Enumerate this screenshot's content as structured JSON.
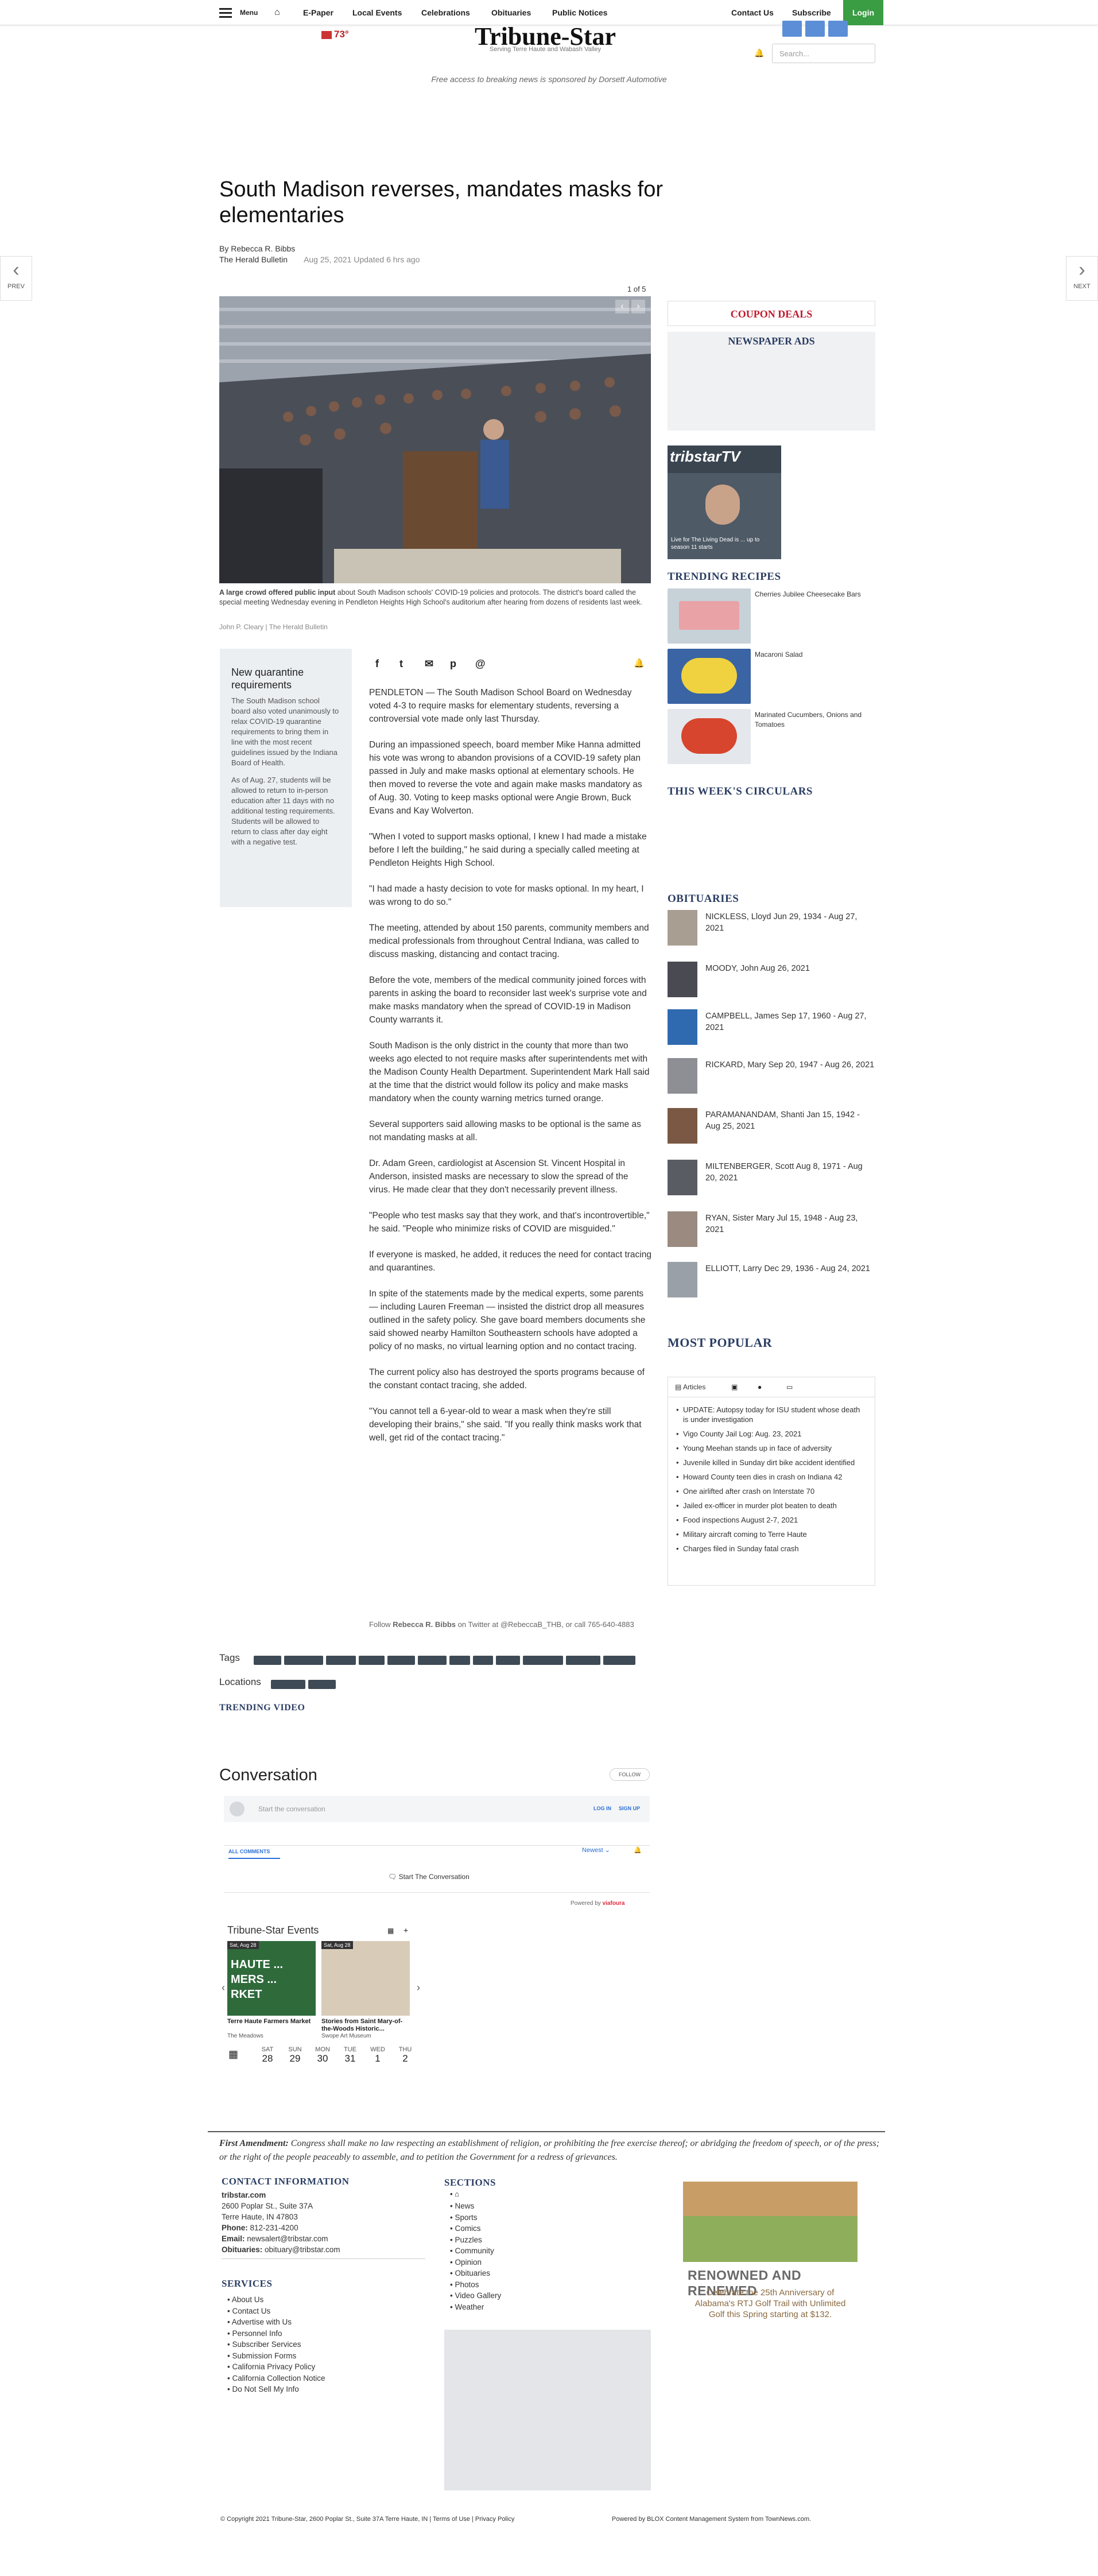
{
  "topnav": {
    "menu": "Menu",
    "items": [
      "E-Paper",
      "Local Events",
      "Celebrations",
      "Obituaries",
      "Public Notices"
    ],
    "right": [
      "Contact Us",
      "Subscribe"
    ],
    "login": "Login"
  },
  "masthead": {
    "logo": "Tribune-Star",
    "tagline": "Serving Terre Haute and Wabash Valley",
    "weather": "73°",
    "search_placeholder": "Search...",
    "sponsor": "Free access to breaking news is sponsored by Dorsett Automotive"
  },
  "pager": {
    "prev": "PREV",
    "next": "NEXT"
  },
  "article": {
    "headline": "South Madison reverses, mandates masks for elementaries",
    "author": "By Rebecca R. Bibbs",
    "outlet": "The Herald Bulletin",
    "date": "Aug 25, 2021 Updated 6 hrs ago",
    "photo_count": "1 of 5",
    "caption_bold": "A large crowd offered public input",
    "caption": " about South Madison schools' COVID-19 policies and protocols. The district's board called the special meeting Wednesday evening in Pendleton Heights High School's auditorium after hearing from dozens of residents last week.",
    "credit": "John P. Cleary | The Herald Bulletin",
    "paragraphs": [
      "PENDLETON — The South Madison School Board on Wednesday voted 4-3 to require masks for elementary students, reversing a controversial vote made only last Thursday.",
      "During an impassioned speech, board member Mike Hanna admitted his vote was wrong to abandon provisions of a COVID-19 safety plan passed in July and make masks optional at elementary schools. He then moved to reverse the vote and again make masks mandatory as of Aug. 30. Voting to keep masks optional were Angie Brown, Buck Evans and Kay Wolverton.",
      "\"When I voted to support masks optional, I knew I had made a mistake before I left the building,\" he said during a specially called meeting at Pendleton Heights High School.",
      "\"I had made a hasty decision to vote for masks optional. In my heart, I was wrong to do so.\"",
      "The meeting, attended by about 150 parents, community members and medical professionals from throughout Central Indiana, was called to discuss masking, distancing and contact tracing.",
      "Before the vote, members of the medical community joined forces with parents in asking the board to reconsider last week's surprise vote and make masks mandatory when the spread of COVID-19 in Madison County warrants it.",
      "South Madison is the only district in the county that more than two weeks ago elected to not require masks after superintendents met with the Madison County Health Department. Superintendent Mark Hall said at the time that the district would follow its policy and make masks mandatory when the county warning metrics turned orange.",
      "Several supporters said allowing masks to be optional is the same as not mandating masks at all.",
      "Dr. Adam Green, cardiologist at Ascension St. Vincent Hospital in Anderson, insisted masks are necessary to slow the spread of the virus. He made clear that they don't necessarily prevent illness.",
      "\"People who test masks say that they work, and that's incontrovertible,\" he said. \"People who minimize risks of COVID are misguided.\"",
      "If everyone is masked, he added, it reduces the need for contact tracing and quarantines.",
      "In spite of the statements made by the medical experts, some parents — including Lauren Freeman — insisted the district drop all measures outlined in the safety policy. She gave board members documents she said showed nearby Hamilton Southeastern schools have adopted a policy of no masks, no virtual learning option and no contact tracing.",
      "The current policy also has destroyed the sports programs because of the constant contact tracing, she added.",
      "\"You cannot tell a 6-year-old to wear a mask when they're still developing their brains,\" she said. \"If you really think masks work that well, get rid of the contact tracing.\""
    ],
    "follow_pre": "Follow ",
    "follow_name": "Rebecca R. Bibbs",
    "follow_post": " on Twitter at @RebeccaB_THB, or call 765-640-4883"
  },
  "sidebox": {
    "title": "New quarantine requirements",
    "p1": "The South Madison school board also voted unanimously to relax COVID-19 quarantine requirements to bring them in line with the most recent guidelines issued by the Indiana Board of Health.",
    "p2": "As of Aug. 27, students will be allowed to return to in-person education after 11 days with no additional testing requirements. Students will be allowed to return to class after day eight with a negative test."
  },
  "tags": {
    "tags_label": "Tags",
    "locations_label": "Locations",
    "trending_video": "TRENDING VIDEO"
  },
  "conversation": {
    "title": "Conversation",
    "follow": "FOLLOW",
    "placeholder": "Start the conversation",
    "log_in": "LOG IN",
    "sign_up": "SIGN UP",
    "all_comments": "ALL COMMENTS",
    "sort": "Newest",
    "start": "Start The Conversation",
    "powered": "Powered by",
    "brand": "viafoura"
  },
  "events": {
    "title": "Tribune-Star Events",
    "cards": [
      {
        "date": "Sat, Aug 28",
        "name": "Terre Haute Farmers Market",
        "venue": "The Meadows",
        "image_text": "HAUTE ... MERS ... RKET"
      },
      {
        "date": "Sat, Aug 28",
        "name": "Stories from Saint Mary-of-the-Woods Historic...",
        "venue": "Swope Art Museum"
      }
    ],
    "days": [
      {
        "dow": "SAT",
        "num": "28"
      },
      {
        "dow": "SUN",
        "num": "29"
      },
      {
        "dow": "MON",
        "num": "30"
      },
      {
        "dow": "TUE",
        "num": "31"
      },
      {
        "dow": "WED",
        "num": "1"
      },
      {
        "dow": "THU",
        "num": "2"
      }
    ]
  },
  "rail": {
    "coupon": "COUPON DEALS",
    "newspaper_ads": "NEWSPAPER ADS",
    "tv_logo": "tribstarTV",
    "tv_caption": "Live for The Living Dead is ... up to season 11 starts",
    "trending_recipes": "TRENDING RECIPES",
    "recipes": [
      "Cherries Jubilee Cheesecake Bars",
      "Macaroni Salad",
      "Marinated Cucumbers, Onions and Tomatoes"
    ],
    "circulars": "THIS WEEK'S CIRCULARS",
    "obituaries_title": "OBITUARIES",
    "obituaries": [
      "NICKLESS, Lloyd Jun 29, 1934 - Aug 27, 2021",
      "MOODY, John Aug 26, 2021",
      "CAMPBELL, James Sep 17, 1960 - Aug 27, 2021",
      "RICKARD, Mary Sep 20, 1947 - Aug 26, 2021",
      "PARAMANANDAM, Shanti Jan 15, 1942 - Aug 25, 2021",
      "MILTENBERGER, Scott Aug 8, 1971 - Aug 20, 2021",
      "RYAN, Sister Mary Jul 15, 1948 - Aug 23, 2021",
      "ELLIOTT, Larry Dec 29, 1936 - Aug 24, 2021"
    ],
    "most_popular": "MOST POPULAR",
    "popular_tab": "Articles",
    "popular": [
      "UPDATE: Autopsy today for ISU student whose death is under investigation",
      "Vigo County Jail Log: Aug. 23, 2021",
      "Young Meehan stands up in face of adversity",
      "Juvenile killed in Sunday dirt bike accident identified",
      "Howard County teen dies in crash on Indiana 42",
      "One airlifted after crash on Interstate 70",
      "Jailed ex-officer in murder plot beaten to death",
      "Food inspections August 2-7, 2021",
      "Military aircraft coming to Terre Haute",
      "Charges filed in Sunday fatal crash"
    ]
  },
  "footer": {
    "first_amendment_label": "First Amendment:",
    "first_amendment": " Congress shall make no law respecting an establishment of religion, or prohibiting the free exercise thereof; or abridging the freedom of speech, or of the press; or the right of the people peaceably to assemble, and to petition the Government for a redress of grievances.",
    "contact_title": "CONTACT INFORMATION",
    "site": "tribstar.com",
    "addr1": "2600 Poplar St., Suite 37A",
    "addr2": "Terre Haute, IN 47803",
    "phone_label": "Phone:",
    "phone": " 812-231-4200",
    "email_label": "Email:",
    "email": " newsalert@tribstar.com",
    "obits_label": "Obituaries:",
    "obits": " obituary@tribstar.com",
    "services_title": "SERVICES",
    "services": [
      "About Us",
      "Contact Us",
      "Advertise with Us",
      "Personnel Info",
      "Subscriber Services",
      "Submission Forms",
      "California Privacy Policy",
      "California Collection Notice",
      "Do Not Sell My Info"
    ],
    "sections_title": "SECTIONS",
    "sections": [
      "News",
      "Sports",
      "Comics",
      "Puzzles",
      "Community",
      "Opinion",
      "Obituaries",
      "Photos",
      "Video Gallery",
      "Weather"
    ],
    "ad_title": "RENOWNED AND RENEWED",
    "ad_text": "Celebrate the 25th Anniversary of Alabama's RTJ Golf Trail with Unlimited Golf this Spring starting at $132.",
    "copyright": "© Copyright 2021 Tribune-Star, 2600 Poplar St., Suite 37A Terre Haute, IN | Terms of Use | Privacy Policy",
    "powered": "Powered by BLOX Content Management System from TownNews.com."
  }
}
